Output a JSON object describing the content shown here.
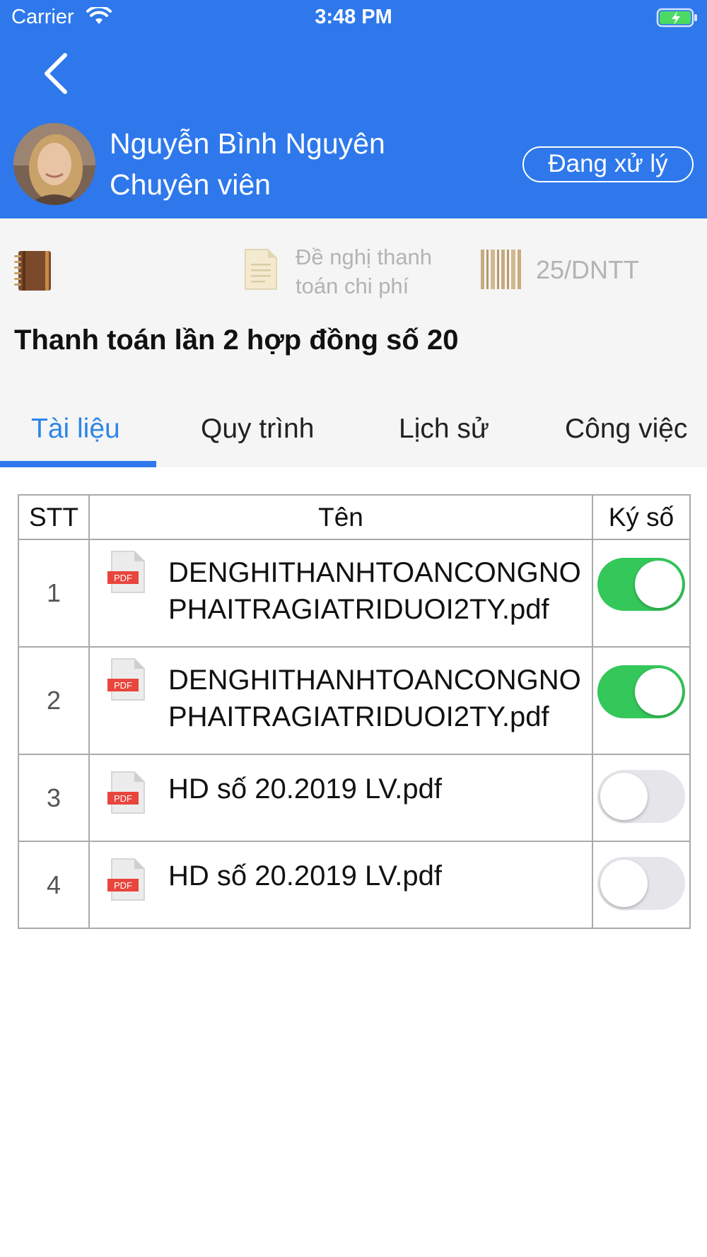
{
  "status_bar": {
    "carrier": "Carrier",
    "time": "3:48 PM"
  },
  "user": {
    "name": "Nguyễn Bình Nguyên",
    "role": "Chuyên viên"
  },
  "status_pill": "Đang xử lý",
  "document": {
    "type_line1": "Đề nghị thanh",
    "type_line2": "toán chi phí",
    "code": "25/DNTT",
    "title": "Thanh toán lần 2 hợp đồng số 20"
  },
  "tabs": [
    {
      "label": "Tài liệu",
      "active": true
    },
    {
      "label": "Quy trình",
      "active": false
    },
    {
      "label": "Lịch sử",
      "active": false
    },
    {
      "label": "Công việc",
      "active": false
    }
  ],
  "table": {
    "headers": {
      "stt": "STT",
      "name": "Tên",
      "sign": "Ký số"
    },
    "rows": [
      {
        "stt": "1",
        "name": "DENGHITHANHTOANCONGNOPHAITRAGIATRIDUOI2TY.pdf",
        "signed": true
      },
      {
        "stt": "2",
        "name": "DENGHITHANHTOANCONGNOPHAITRAGIATRIDUOI2TY.pdf",
        "signed": true
      },
      {
        "stt": "3",
        "name": "HD số 20.2019 LV.pdf",
        "signed": false
      },
      {
        "stt": "4",
        "name": "HD số 20.2019 LV.pdf",
        "signed": false
      }
    ]
  },
  "icons": {
    "back": "chevron-left-icon",
    "book": "book-icon",
    "doc": "document-icon",
    "barcode": "barcode-icon",
    "file": "pdf-file-icon"
  },
  "colors": {
    "header": "#2e78ec",
    "accent": "#2e86e6",
    "toggle_on": "#34c759",
    "toggle_off": "#e5e5ea"
  }
}
